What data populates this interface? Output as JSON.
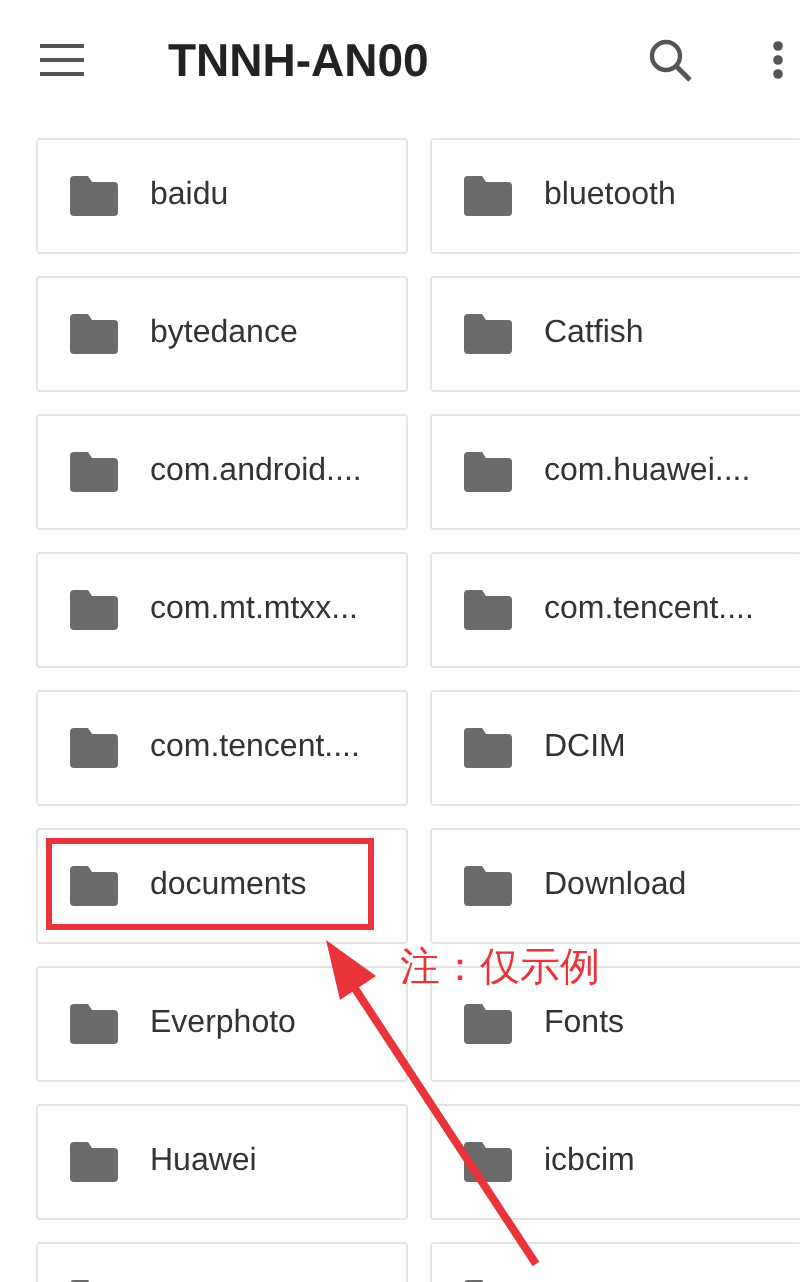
{
  "toolbar": {
    "title": "TNNH-AN00"
  },
  "folders": [
    {
      "kind": "folder",
      "name": "baidu",
      "highlighted": false
    },
    {
      "kind": "folder",
      "name": "bluetooth",
      "highlighted": false
    },
    {
      "kind": "folder",
      "name": "bytedance",
      "highlighted": false
    },
    {
      "kind": "folder",
      "name": "Catfish",
      "highlighted": false
    },
    {
      "kind": "folder",
      "name": "com.android....",
      "highlighted": false
    },
    {
      "kind": "folder",
      "name": "com.huawei....",
      "highlighted": false
    },
    {
      "kind": "folder",
      "name": "com.mt.mtxx...",
      "highlighted": false
    },
    {
      "kind": "folder",
      "name": "com.tencent....",
      "highlighted": false
    },
    {
      "kind": "folder",
      "name": "com.tencent....",
      "highlighted": false
    },
    {
      "kind": "folder",
      "name": "DCIM",
      "highlighted": false
    },
    {
      "kind": "folder",
      "name": "documents",
      "highlighted": true
    },
    {
      "kind": "folder",
      "name": "Download",
      "highlighted": false
    },
    {
      "kind": "folder",
      "name": "Everphoto",
      "highlighted": false
    },
    {
      "kind": "folder",
      "name": "Fonts",
      "highlighted": false
    },
    {
      "kind": "folder",
      "name": "Huawei",
      "highlighted": false
    },
    {
      "kind": "folder",
      "name": "icbcim",
      "highlighted": false
    },
    {
      "kind": "partial"
    },
    {
      "kind": "partial"
    }
  ],
  "annotation": {
    "note": "注：仅示例"
  }
}
